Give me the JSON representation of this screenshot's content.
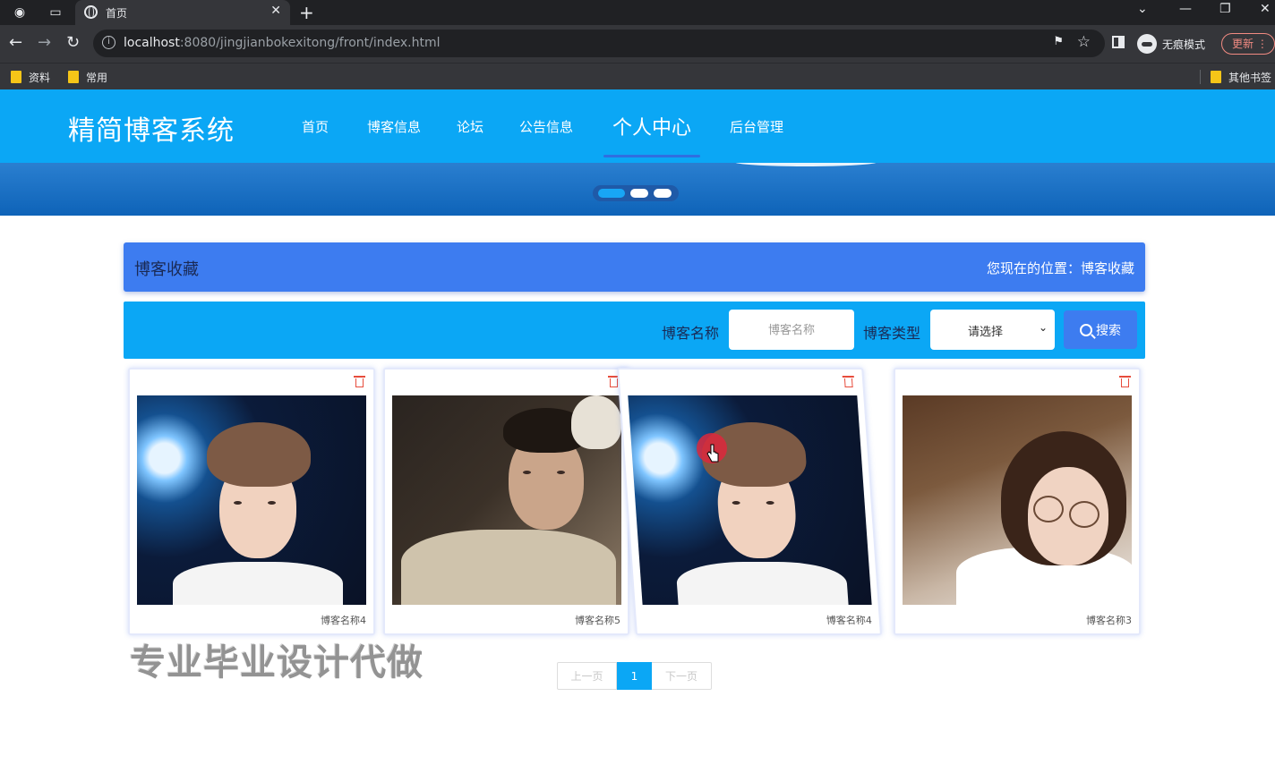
{
  "browser": {
    "tab_title": "首页",
    "url_host": "localhost",
    "url_rest": ":8080/jingjianbokexitong/front/index.html",
    "incognito_label": "无痕模式",
    "update_label": "更新",
    "bookmarks": [
      "资料",
      "常用"
    ],
    "other_bookmarks": "其他书签"
  },
  "site": {
    "logo": "精简博客系统",
    "nav": [
      "首页",
      "博客信息",
      "论坛",
      "公告信息",
      "个人中心",
      "后台管理"
    ],
    "active_nav": "个人中心",
    "accent_color": "#0ba7f5"
  },
  "page": {
    "title": "博客收藏",
    "location_label": "您现在的位置：博客收藏"
  },
  "search": {
    "name_label": "博客名称",
    "name_placeholder": "博客名称",
    "type_label": "博客类型",
    "type_value": "请选择",
    "button_label": "搜索"
  },
  "cards": [
    {
      "name": "博客名称4"
    },
    {
      "name": "博客名称5"
    },
    {
      "name": "博客名称4"
    },
    {
      "name": "博客名称3"
    }
  ],
  "watermark": "专业毕业设计代做",
  "pagination": {
    "prev": "上一页",
    "current": "1",
    "next": "下一页"
  }
}
